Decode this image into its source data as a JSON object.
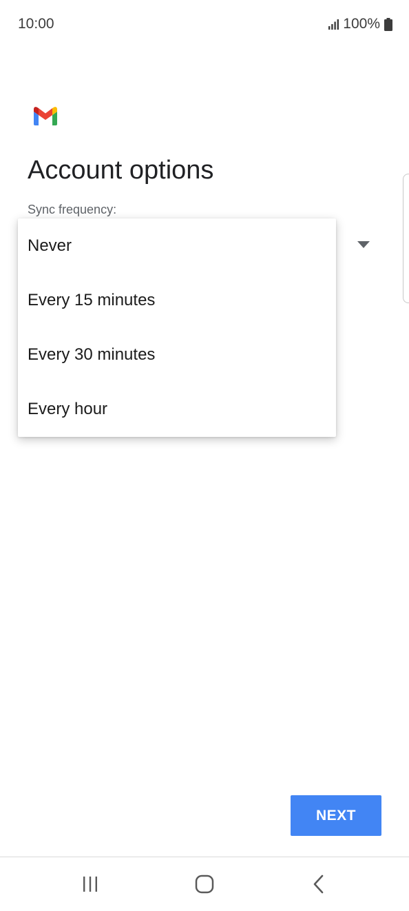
{
  "status_bar": {
    "time": "10:00",
    "battery": "100%",
    "signal_icon": "signal-icon",
    "battery_icon": "battery-icon"
  },
  "app": {
    "logo_icon": "gmail-logo-icon",
    "brand_colors": {
      "blue": "#4285F4",
      "red": "#EA4335",
      "yellow": "#FBBC04",
      "green": "#34A853"
    }
  },
  "page": {
    "title": "Account options",
    "sync_label": "Sync frequency:"
  },
  "dropdown": {
    "options": [
      {
        "label": "Never"
      },
      {
        "label": "Every 15 minutes"
      },
      {
        "label": "Every 30 minutes"
      },
      {
        "label": "Every hour"
      }
    ]
  },
  "actions": {
    "next_label": "NEXT",
    "next_color": "#4285F4"
  },
  "nav_bar": {
    "recents_icon": "recents-icon",
    "home_icon": "home-icon",
    "back_icon": "back-icon"
  }
}
